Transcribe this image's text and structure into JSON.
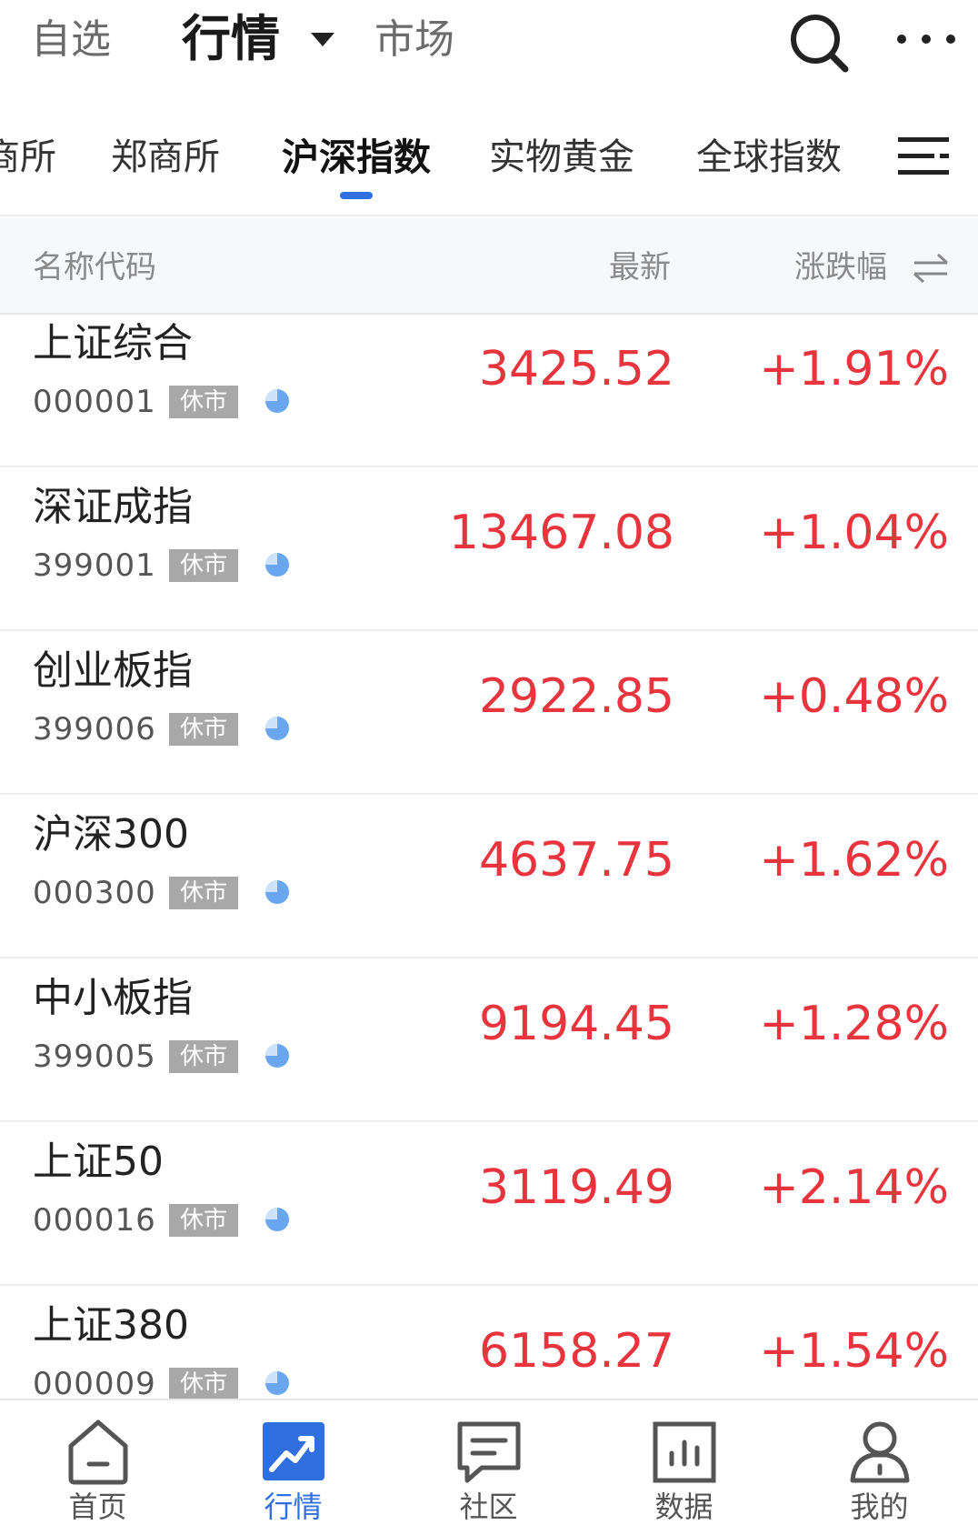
{
  "topbar": {
    "tabs": [
      "自选",
      "行情",
      "市场"
    ],
    "active_tab": "行情"
  },
  "market_tabs": {
    "items": [
      "商所",
      "郑商所",
      "沪深指数",
      "实物黄金",
      "全球指数"
    ],
    "active": "沪深指数"
  },
  "table": {
    "columns": [
      "名称代码",
      "最新",
      "涨跌幅"
    ],
    "rows": [
      {
        "name": "上证综合",
        "code": "000001",
        "status": "休市",
        "price": "3425.52",
        "change": "+1.91%"
      },
      {
        "name": "深证成指",
        "code": "399001",
        "status": "休市",
        "price": "13467.08",
        "change": "+1.04%"
      },
      {
        "name": "创业板指",
        "code": "399006",
        "status": "休市",
        "price": "2922.85",
        "change": "+0.48%"
      },
      {
        "name": "沪深300",
        "code": "000300",
        "status": "休市",
        "price": "4637.75",
        "change": "+1.62%"
      },
      {
        "name": "中小板指",
        "code": "399005",
        "status": "休市",
        "price": "9194.45",
        "change": "+1.28%"
      },
      {
        "name": "上证50",
        "code": "000016",
        "status": "休市",
        "price": "3119.49",
        "change": "+2.14%"
      },
      {
        "name": "上证380",
        "code": "000009",
        "status": "休市",
        "price": "6158.27",
        "change": "+1.54%"
      }
    ]
  },
  "bottom_nav": {
    "items": [
      {
        "label": "首页",
        "icon": "home-icon"
      },
      {
        "label": "行情",
        "icon": "market-trend-icon"
      },
      {
        "label": "社区",
        "icon": "community-chat-icon"
      },
      {
        "label": "数据",
        "icon": "data-bar-chart-icon"
      },
      {
        "label": "我的",
        "icon": "profile-icon"
      }
    ],
    "active": "行情"
  },
  "colors": {
    "rise": "#e8353d",
    "accent": "#2f6fe0",
    "badge": "#a8a8a8"
  }
}
